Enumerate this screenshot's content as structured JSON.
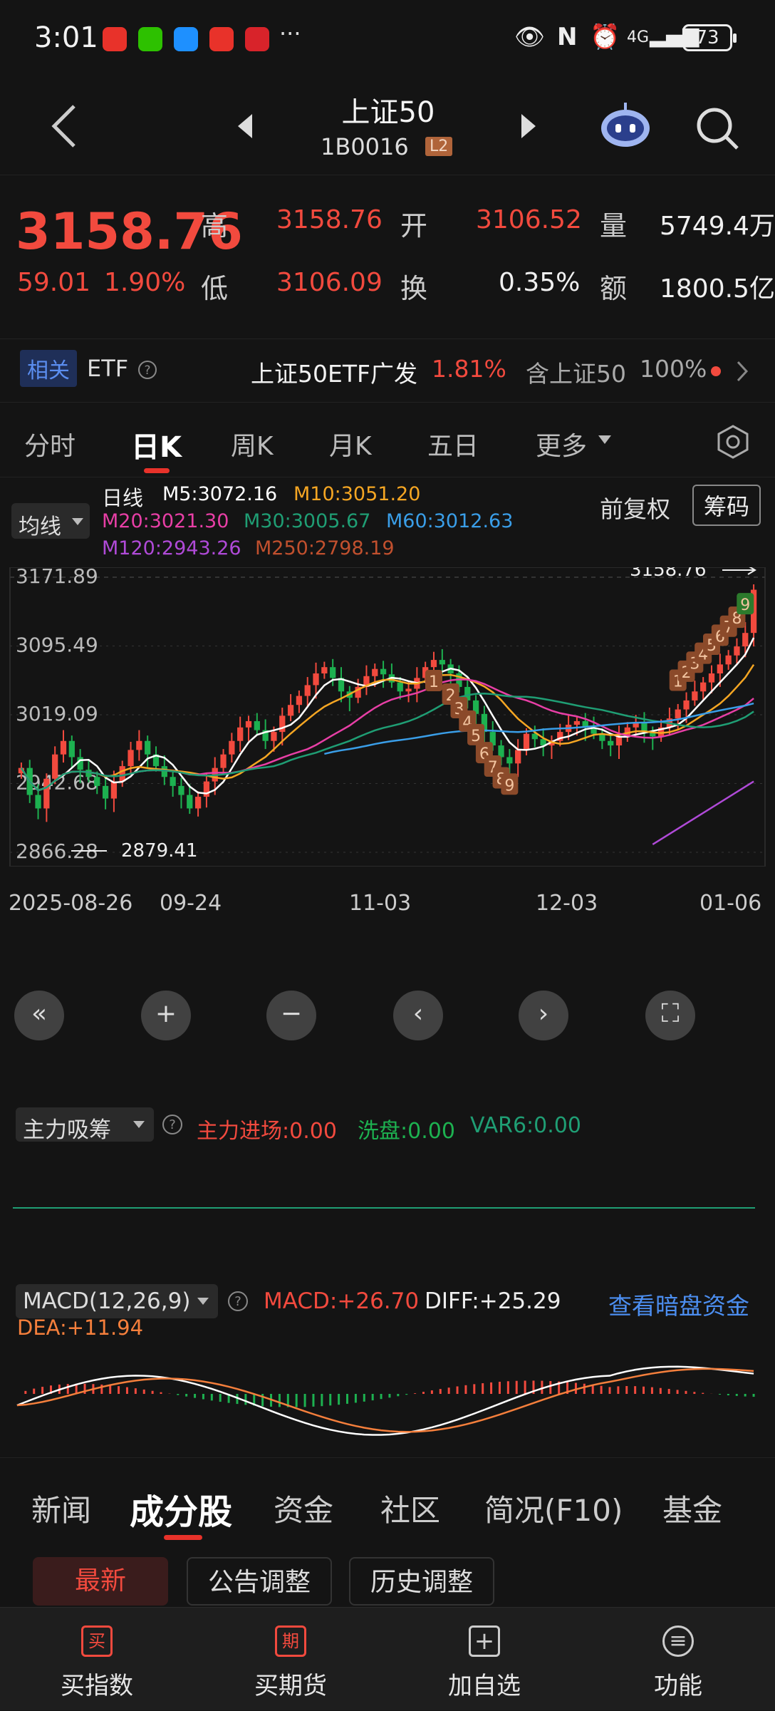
{
  "status": {
    "time": "3:01",
    "dots": "···",
    "network": "4G",
    "battery": "73"
  },
  "header": {
    "title": "上证50",
    "code": "1B0016",
    "level": "L2"
  },
  "quote": {
    "price": "3158.76",
    "change": "59.01",
    "change_pct": "1.90%",
    "high_label": "高",
    "high": "3158.76",
    "open_label": "开",
    "open": "3106.52",
    "vol_label": "量",
    "vol": "5749.4万",
    "low_label": "低",
    "low": "3106.09",
    "turn_label": "换",
    "turn": "0.35%",
    "amt_label": "额",
    "amt": "1800.5亿"
  },
  "etf": {
    "tag": "相关",
    "name": "ETF",
    "etf_name": "上证50ETF广发",
    "etf_pct": "1.81%",
    "contain_label": "含上证50",
    "contain_pct": "100%"
  },
  "tabs": [
    "分时",
    "日K",
    "周K",
    "月K",
    "五日",
    "更多"
  ],
  "ma": {
    "selector": "均线",
    "daily": "日线",
    "m5": "M5:3072.16",
    "m10": "M10:3051.20",
    "m20": "M20:3021.30",
    "m30": "M30:3005.67",
    "m60": "M60:3012.63",
    "m120": "M120:2943.26",
    "m250": "M250:2798.19",
    "fq": "前复权",
    "chip": "筹码"
  },
  "colors": {
    "up": "#f24a3e",
    "down": "#1db150",
    "m5": "#ffffff",
    "m10": "#f5a623",
    "m20": "#e83fa6",
    "m30": "#1f9e74",
    "m60": "#3a9ee8",
    "m120": "#b04ad8",
    "m250": "#c1502e"
  },
  "chart_data": {
    "type": "candlestick",
    "y_ticks": [
      "3171.89",
      "3095.49",
      "3019.09",
      "2942.68",
      "2866.28"
    ],
    "ylim": [
      2866.28,
      3171.89
    ],
    "x_ticks": [
      "2025-08-26",
      "09-24",
      "11-03",
      "12-03",
      "01-06"
    ],
    "last_price_label": "3158.76",
    "low_label": "2879.41",
    "td_labels": [
      "1",
      "2",
      "3",
      "4",
      "5",
      "6",
      "7",
      "8",
      "9",
      "1",
      "2",
      "3",
      "4",
      "5",
      "6",
      "7",
      "8",
      "9"
    ],
    "closes": [
      2960,
      2930,
      2915,
      2948,
      2975,
      2990,
      2972,
      2958,
      2950,
      2940,
      2926,
      2945,
      2962,
      2980,
      2990,
      2975,
      2962,
      2950,
      2940,
      2930,
      2915,
      2928,
      2945,
      2960,
      2975,
      2990,
      3005,
      3012,
      3002,
      2990,
      3000,
      3018,
      3030,
      3040,
      3052,
      3065,
      3072,
      3060,
      3045,
      3038,
      3050,
      3062,
      3070,
      3064,
      3055,
      3045,
      3048,
      3060,
      3072,
      3080,
      3075,
      3065,
      3050,
      3035,
      3020,
      3000,
      2985,
      2972,
      2965,
      2980,
      2998,
      2992,
      2985,
      2990,
      3000,
      3008,
      3012,
      3005,
      2998,
      2990,
      2985,
      2995,
      3005,
      3010,
      3000,
      2995,
      3005,
      3015,
      3025,
      3035,
      3045,
      3055,
      3065,
      3075,
      3085,
      3095,
      3110,
      3158
    ]
  },
  "indicator1": {
    "name": "主力吸筹",
    "v1": "主力进场:0.00",
    "v2": "洗盘:0.00",
    "v3": "VAR6:0.00"
  },
  "macd": {
    "name": "MACD(12,26,9)",
    "macd": "MACD:+26.70",
    "diff": "DIFF:+25.29",
    "dea": "DEA:+11.94",
    "link": "查看暗盘资金"
  },
  "bottom_tabs": [
    "新闻",
    "成分股",
    "资金",
    "社区",
    "简况(F10)",
    "基金"
  ],
  "sub_buttons": [
    "最新",
    "公告调整",
    "历史调整"
  ],
  "nav": [
    {
      "icon": "买",
      "label": "买指数"
    },
    {
      "icon": "期",
      "label": "买期货"
    },
    {
      "icon": "+",
      "label": "加自选"
    },
    {
      "icon": "≡",
      "label": "功能"
    }
  ]
}
